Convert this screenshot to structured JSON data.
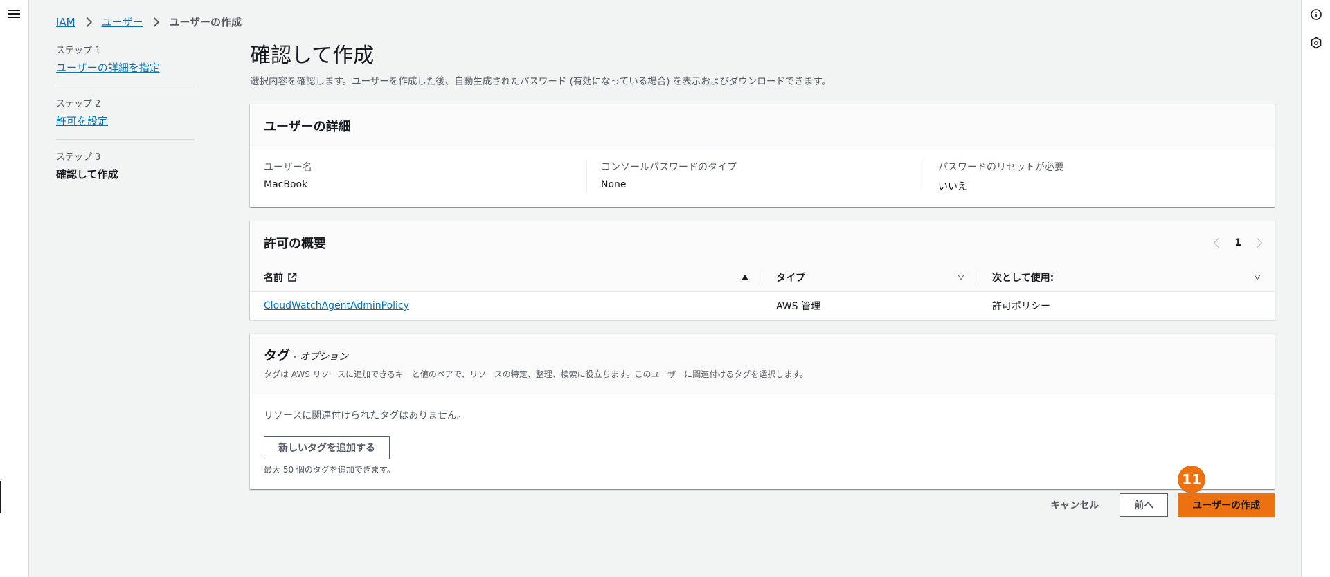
{
  "breadcrumb": {
    "root": "IAM",
    "parent": "ユーザー",
    "current": "ユーザーの作成"
  },
  "steps": [
    {
      "num": "ステップ 1",
      "label": "ユーザーの詳細を指定"
    },
    {
      "num": "ステップ 2",
      "label": "許可を設定"
    },
    {
      "num": "ステップ 3",
      "label": "確認して作成"
    }
  ],
  "page": {
    "title": "確認して作成",
    "description": "選択内容を確認します。ユーザーを作成した後、自動生成されたパスワード (有効になっている場合) を表示およびダウンロードできます。"
  },
  "user_details": {
    "title": "ユーザーの詳細",
    "fields": [
      {
        "key": "ユーザー名",
        "value": "MacBook"
      },
      {
        "key": "コンソールパスワードのタイプ",
        "value": "None"
      },
      {
        "key": "パスワードのリセットが必要",
        "value": "いいえ"
      }
    ]
  },
  "permissions": {
    "title": "許可の概要",
    "page": "1",
    "columns": [
      "名前",
      "タイプ",
      "次として使用:"
    ],
    "rows": [
      {
        "name": "CloudWatchAgentAdminPolicy",
        "type": "AWS 管理",
        "used_as": "許可ポリシー"
      }
    ]
  },
  "tags": {
    "title": "タグ",
    "optional": " - オプション",
    "description": "タグは AWS リソースに追加できるキーと値のペアで、リソースの特定、整理、検索に役立ちます。このユーザーに関連付けるタグを選択します。",
    "empty": "リソースに関連付けられたタグはありません。",
    "add_button": "新しいタグを追加する",
    "hint": "最大 50 個のタグを追加できます。"
  },
  "actions": {
    "cancel": "キャンセル",
    "previous": "前へ",
    "create": "ユーザーの作成"
  },
  "annotation_badge": "11",
  "colors": {
    "accent": "#ec7211",
    "link": "#0073bb"
  },
  "icons": {
    "menu": "hamburger-menu-icon",
    "info": "info-icon",
    "feedback": "hexagon-feedback-icon",
    "external": "external-link-icon"
  }
}
